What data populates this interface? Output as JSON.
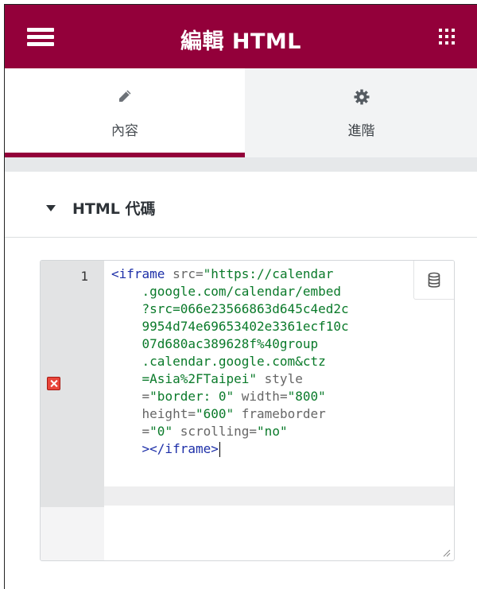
{
  "header": {
    "title": "編輯 HTML",
    "menu_icon": "hamburger-icon",
    "apps_icon": "grid-icon",
    "brand_color": "#93003a"
  },
  "tabs": [
    {
      "label": "內容",
      "icon": "pencil-icon",
      "active": true
    },
    {
      "label": "進階",
      "icon": "gear-icon",
      "active": false
    }
  ],
  "section": {
    "title": "HTML 代碼",
    "collapse_icon": "caret-down-icon"
  },
  "editor": {
    "line_number": "1",
    "error_icon": "error-icon",
    "dynamic_tags_icon": "database-icon",
    "code_lines": [
      {
        "parts": [
          [
            "tag",
            "<iframe"
          ],
          [
            "attr",
            " src="
          ],
          [
            "str",
            "\"https://calendar"
          ]
        ]
      },
      {
        "parts": [
          [
            "str",
            "    .google.com/calendar/embed"
          ]
        ]
      },
      {
        "parts": [
          [
            "str",
            "    ?src=066e23566863d645c4ed2c"
          ]
        ]
      },
      {
        "parts": [
          [
            "str",
            "    9954d74e69653402e3361ecf10c"
          ]
        ]
      },
      {
        "parts": [
          [
            "str",
            "    07d680ac389628f%40group"
          ]
        ]
      },
      {
        "parts": [
          [
            "str",
            "    .calendar.google.com&ctz"
          ]
        ]
      },
      {
        "parts": [
          [
            "str",
            "    =Asia%2FTaipei\""
          ],
          [
            "attr",
            " style"
          ]
        ]
      },
      {
        "parts": [
          [
            "attr",
            "    ="
          ],
          [
            "str",
            "\"border: 0\""
          ],
          [
            "attr",
            " width="
          ],
          [
            "str",
            "\"800\""
          ]
        ]
      },
      {
        "parts": [
          [
            "attr",
            "    height="
          ],
          [
            "str",
            "\"600\""
          ],
          [
            "attr",
            " frameborder"
          ]
        ]
      },
      {
        "parts": [
          [
            "attr",
            "    ="
          ],
          [
            "str",
            "\"0\""
          ],
          [
            "attr",
            " scrolling="
          ],
          [
            "str",
            "\"no\""
          ]
        ]
      },
      {
        "parts": [
          [
            "tag",
            "    ></iframe>"
          ]
        ]
      }
    ]
  }
}
